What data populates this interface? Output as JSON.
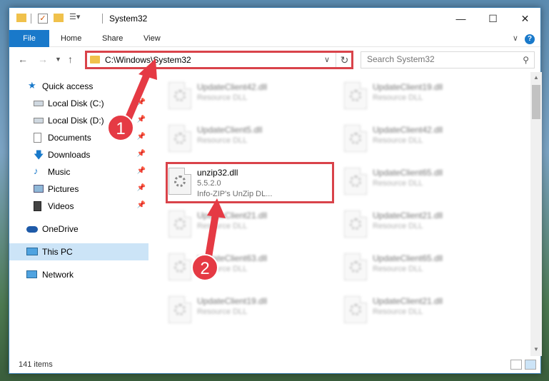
{
  "title": "System32",
  "ribbon": {
    "tabs": [
      "File",
      "Home",
      "Share",
      "View"
    ],
    "help_label": "?"
  },
  "nav": {
    "address": "C:\\Windows\\System32",
    "search_placeholder": "Search System32"
  },
  "sidebar": {
    "items": [
      {
        "label": "Quick access"
      },
      {
        "label": "Local Disk (C:)"
      },
      {
        "label": "Local Disk (D:)"
      },
      {
        "label": "Documents"
      },
      {
        "label": "Downloads"
      },
      {
        "label": "Music"
      },
      {
        "label": "Pictures"
      },
      {
        "label": "Videos"
      },
      {
        "label": "OneDrive"
      },
      {
        "label": "This PC"
      },
      {
        "label": "Network"
      }
    ]
  },
  "files": {
    "left": [
      {
        "name": "UpdateClient42.dll",
        "type": "Resource DLL"
      },
      {
        "name": "UpdateClient5.dll",
        "type": "Resource DLL"
      },
      {
        "name": "unzip32.dll",
        "type": "5.5.2.0",
        "desc": "Info-ZIP's UnZip DL..."
      },
      {
        "name": "UpdateClient21.dll",
        "type": "Resource DLL"
      },
      {
        "name": "UpdateClient63.dll",
        "type": "Resource DLL"
      },
      {
        "name": "UpdateClient19.dll",
        "type": "Resource DLL"
      }
    ],
    "right": [
      {
        "name": "UpdateClient19.dll",
        "type": "Resource DLL"
      },
      {
        "name": "UpdateClient42.dll",
        "type": "Resource DLL"
      },
      {
        "name": "UpdateClient65.dll",
        "type": "Resource DLL"
      },
      {
        "name": "UpdateClient21.dll",
        "type": "Resource DLL"
      },
      {
        "name": "UpdateClient65.dll",
        "type": "Resource DLL"
      },
      {
        "name": "UpdateClient21.dll",
        "type": "Resource DLL"
      }
    ]
  },
  "status": {
    "item_count": "141 items"
  },
  "annotations": {
    "step1": "1",
    "step2": "2"
  },
  "colors": {
    "accent": "#1979ca",
    "highlight": "#d9434a",
    "callout": "#e53a44",
    "selected": "#cce4f7"
  }
}
